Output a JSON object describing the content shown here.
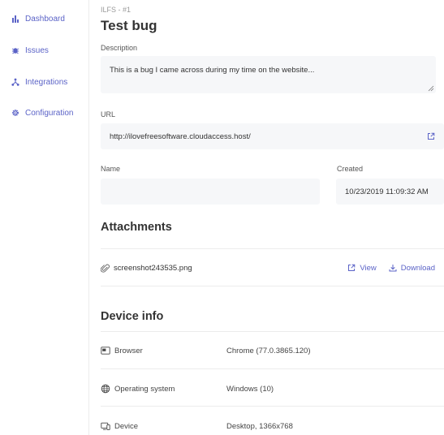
{
  "sidebar": {
    "items": [
      {
        "label": "Dashboard",
        "icon": "bar-chart-icon"
      },
      {
        "label": "Issues",
        "icon": "bug-icon"
      },
      {
        "label": "Integrations",
        "icon": "fork-icon"
      },
      {
        "label": "Configuration",
        "icon": "gear-icon"
      }
    ]
  },
  "ticket": {
    "key": "ILFS - #1",
    "title": "Test bug",
    "description_label": "Description",
    "description": "This is a bug I came across during my time on the website...",
    "url_label": "URL",
    "url": "http://ilovefreesoftware.cloudaccess.host/",
    "name_label": "Name",
    "name_value": "",
    "created_label": "Created",
    "created_value": "10/23/2019 11:09:32 AM"
  },
  "attachments": {
    "title": "Attachments",
    "items": [
      {
        "filename": "screenshot243535.png",
        "view_label": "View",
        "download_label": "Download"
      }
    ]
  },
  "device_info": {
    "title": "Device info",
    "rows": [
      {
        "label": "Browser",
        "value": "Chrome (77.0.3865.120)",
        "icon": "browser-icon"
      },
      {
        "label": "Operating system",
        "value": "Windows (10)",
        "icon": "globe-icon"
      },
      {
        "label": "Device",
        "value": "Desktop, 1366x768",
        "icon": "device-icon"
      }
    ]
  },
  "colors": {
    "accent": "#5b63c7",
    "field_bg": "#f6f7f9",
    "divider": "#ececec"
  }
}
